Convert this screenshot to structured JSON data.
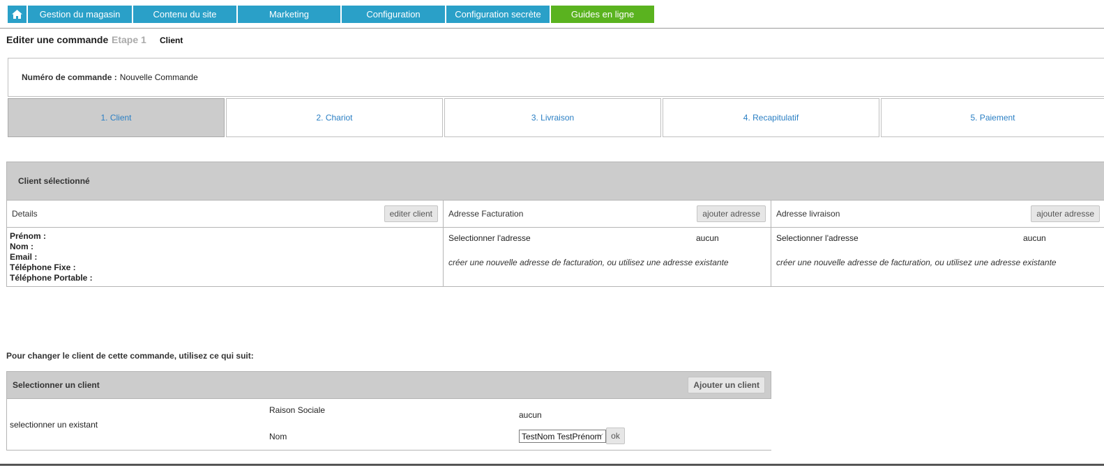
{
  "nav": {
    "home_icon": "home-icon",
    "items": [
      {
        "label": "Gestion du magasin"
      },
      {
        "label": "Contenu du site"
      },
      {
        "label": "Marketing"
      },
      {
        "label": "Configuration"
      },
      {
        "label": "Configuration secrète"
      },
      {
        "label": "Guides en ligne"
      }
    ],
    "colors": {
      "primary": "#2aa0c8",
      "highlight": "#5ab31f"
    }
  },
  "page": {
    "title": "Editer une commande",
    "step": "Etape 1",
    "subtitle": "Client"
  },
  "order": {
    "label": "Numéro de commande :",
    "value": "Nouvelle Commande"
  },
  "steps": [
    {
      "label": "1. Client",
      "active": true
    },
    {
      "label": "2. Chariot"
    },
    {
      "label": "3. Livraison"
    },
    {
      "label": "4. Recapitulatif"
    },
    {
      "label": "5. Paiement"
    }
  ],
  "client_panel": {
    "title": "Client sélectionné",
    "details": {
      "header": "Details",
      "edit_button": "editer client",
      "fields": [
        "Prénom :",
        "Nom :",
        "Email :",
        "Téléphone Fixe :",
        "Téléphone Portable :"
      ]
    },
    "billing": {
      "header": "Adresse Facturation",
      "add_button": "ajouter adresse",
      "select_label": "Selectionner l'adresse",
      "select_value": "aucun",
      "hint": "créer une nouvelle adresse de facturation, ou utilisez une adresse existante"
    },
    "shipping": {
      "header": "Adresse livraison",
      "add_button": "ajouter adresse",
      "select_label": "Selectionner l'adresse",
      "select_value": "aucun",
      "hint": "créer une nouvelle adresse de facturation, ou utilisez une adresse existante"
    }
  },
  "change_client": {
    "note": "Pour changer le client de cette commande, utilisez ce qui suit:",
    "title": "Selectionner un client",
    "add_button": "Ajouter un client",
    "existing_label": "selectionner un existant",
    "raison_sociale_label": "Raison Sociale",
    "raison_sociale_value": "aucun",
    "nom_label": "Nom",
    "nom_selected": "TestNom TestPrénom",
    "ok_button": "ok"
  }
}
